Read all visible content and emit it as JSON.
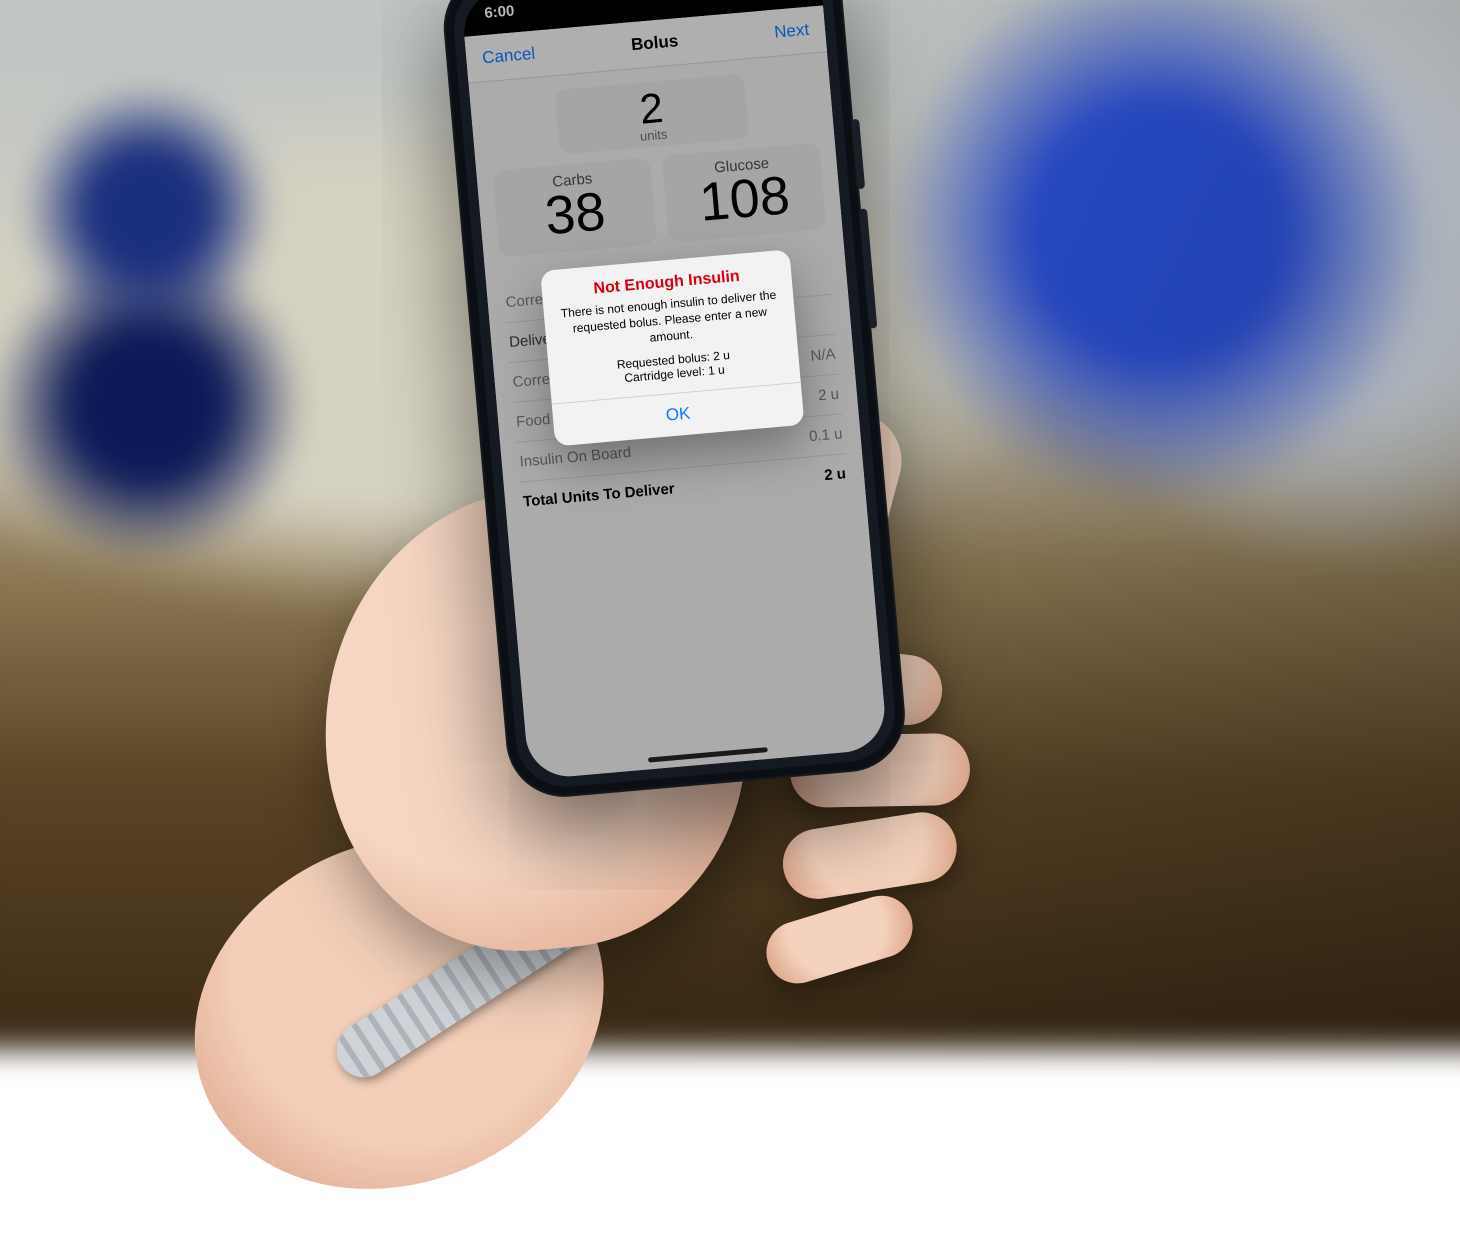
{
  "status": {
    "time": "6:00"
  },
  "nav": {
    "cancel": "Cancel",
    "title": "Bolus",
    "next": "Next"
  },
  "dose": {
    "value": "2",
    "unit_label": "units"
  },
  "carbs": {
    "label": "Carbs",
    "value": "38"
  },
  "glucose": {
    "label": "Glucose",
    "value": "108"
  },
  "rows": {
    "correction_bolus": {
      "label": "Correction Bolus",
      "value": ""
    },
    "delivery": {
      "label": "Delivery",
      "value": ""
    },
    "correction": {
      "label": "Correction",
      "value": "N/A"
    },
    "food": {
      "label": "Food",
      "value": "2 u"
    },
    "iob": {
      "label": "Insulin On Board",
      "value": "0.1 u"
    },
    "total": {
      "label": "Total Units To Deliver",
      "value": "2 u"
    }
  },
  "alert": {
    "title": "Not Enough Insulin",
    "message": "There is not enough insulin to deliver the requested bolus. Please enter a new amount.",
    "requested_line": "Requested bolus: 2 u",
    "cartridge_line": "Cartridge level: 1 u",
    "ok": "OK"
  }
}
